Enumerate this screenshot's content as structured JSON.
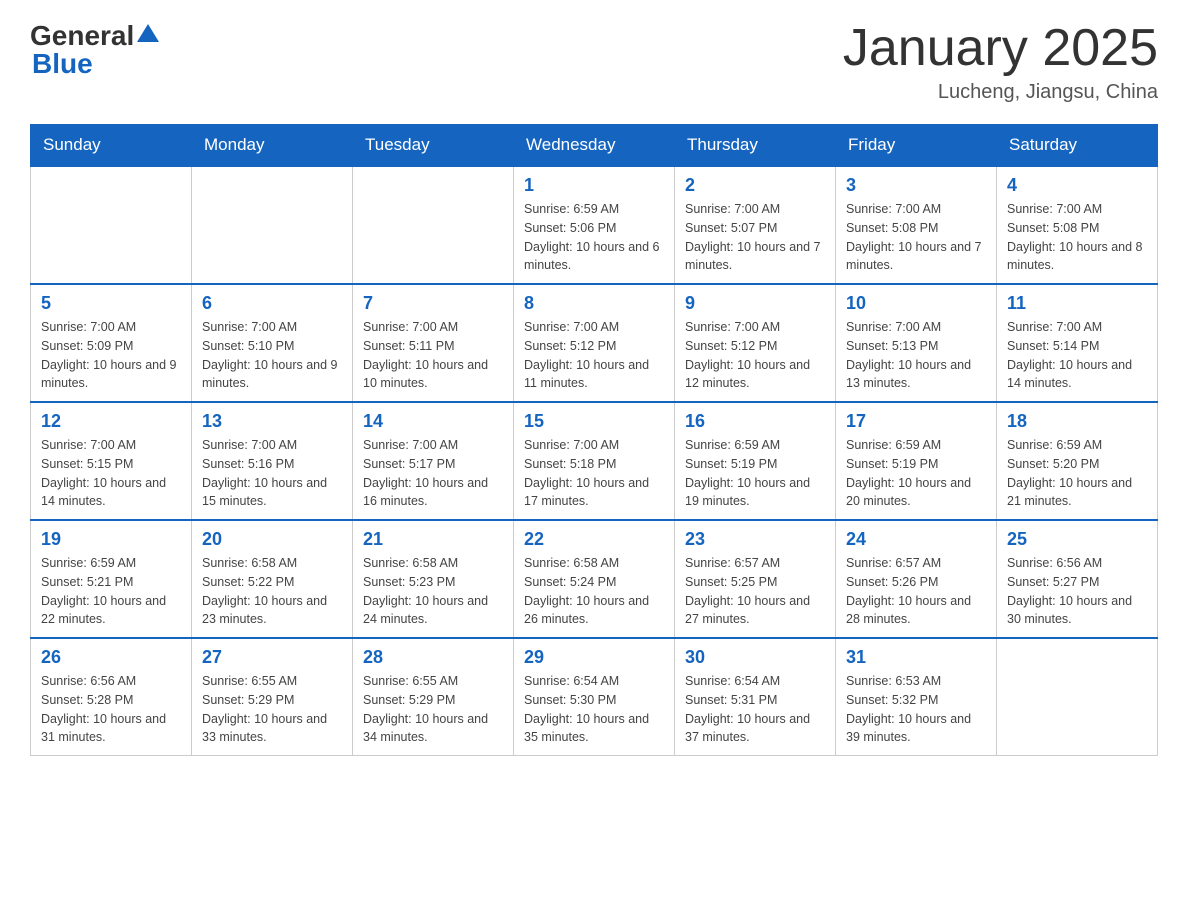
{
  "logo": {
    "general": "General",
    "blue": "Blue"
  },
  "header": {
    "title": "January 2025",
    "subtitle": "Lucheng, Jiangsu, China"
  },
  "weekdays": [
    "Sunday",
    "Monday",
    "Tuesday",
    "Wednesday",
    "Thursday",
    "Friday",
    "Saturday"
  ],
  "weeks": [
    [
      {
        "day": "",
        "info": ""
      },
      {
        "day": "",
        "info": ""
      },
      {
        "day": "",
        "info": ""
      },
      {
        "day": "1",
        "info": "Sunrise: 6:59 AM\nSunset: 5:06 PM\nDaylight: 10 hours and 6 minutes."
      },
      {
        "day": "2",
        "info": "Sunrise: 7:00 AM\nSunset: 5:07 PM\nDaylight: 10 hours and 7 minutes."
      },
      {
        "day": "3",
        "info": "Sunrise: 7:00 AM\nSunset: 5:08 PM\nDaylight: 10 hours and 7 minutes."
      },
      {
        "day": "4",
        "info": "Sunrise: 7:00 AM\nSunset: 5:08 PM\nDaylight: 10 hours and 8 minutes."
      }
    ],
    [
      {
        "day": "5",
        "info": "Sunrise: 7:00 AM\nSunset: 5:09 PM\nDaylight: 10 hours and 9 minutes."
      },
      {
        "day": "6",
        "info": "Sunrise: 7:00 AM\nSunset: 5:10 PM\nDaylight: 10 hours and 9 minutes."
      },
      {
        "day": "7",
        "info": "Sunrise: 7:00 AM\nSunset: 5:11 PM\nDaylight: 10 hours and 10 minutes."
      },
      {
        "day": "8",
        "info": "Sunrise: 7:00 AM\nSunset: 5:12 PM\nDaylight: 10 hours and 11 minutes."
      },
      {
        "day": "9",
        "info": "Sunrise: 7:00 AM\nSunset: 5:12 PM\nDaylight: 10 hours and 12 minutes."
      },
      {
        "day": "10",
        "info": "Sunrise: 7:00 AM\nSunset: 5:13 PM\nDaylight: 10 hours and 13 minutes."
      },
      {
        "day": "11",
        "info": "Sunrise: 7:00 AM\nSunset: 5:14 PM\nDaylight: 10 hours and 14 minutes."
      }
    ],
    [
      {
        "day": "12",
        "info": "Sunrise: 7:00 AM\nSunset: 5:15 PM\nDaylight: 10 hours and 14 minutes."
      },
      {
        "day": "13",
        "info": "Sunrise: 7:00 AM\nSunset: 5:16 PM\nDaylight: 10 hours and 15 minutes."
      },
      {
        "day": "14",
        "info": "Sunrise: 7:00 AM\nSunset: 5:17 PM\nDaylight: 10 hours and 16 minutes."
      },
      {
        "day": "15",
        "info": "Sunrise: 7:00 AM\nSunset: 5:18 PM\nDaylight: 10 hours and 17 minutes."
      },
      {
        "day": "16",
        "info": "Sunrise: 6:59 AM\nSunset: 5:19 PM\nDaylight: 10 hours and 19 minutes."
      },
      {
        "day": "17",
        "info": "Sunrise: 6:59 AM\nSunset: 5:19 PM\nDaylight: 10 hours and 20 minutes."
      },
      {
        "day": "18",
        "info": "Sunrise: 6:59 AM\nSunset: 5:20 PM\nDaylight: 10 hours and 21 minutes."
      }
    ],
    [
      {
        "day": "19",
        "info": "Sunrise: 6:59 AM\nSunset: 5:21 PM\nDaylight: 10 hours and 22 minutes."
      },
      {
        "day": "20",
        "info": "Sunrise: 6:58 AM\nSunset: 5:22 PM\nDaylight: 10 hours and 23 minutes."
      },
      {
        "day": "21",
        "info": "Sunrise: 6:58 AM\nSunset: 5:23 PM\nDaylight: 10 hours and 24 minutes."
      },
      {
        "day": "22",
        "info": "Sunrise: 6:58 AM\nSunset: 5:24 PM\nDaylight: 10 hours and 26 minutes."
      },
      {
        "day": "23",
        "info": "Sunrise: 6:57 AM\nSunset: 5:25 PM\nDaylight: 10 hours and 27 minutes."
      },
      {
        "day": "24",
        "info": "Sunrise: 6:57 AM\nSunset: 5:26 PM\nDaylight: 10 hours and 28 minutes."
      },
      {
        "day": "25",
        "info": "Sunrise: 6:56 AM\nSunset: 5:27 PM\nDaylight: 10 hours and 30 minutes."
      }
    ],
    [
      {
        "day": "26",
        "info": "Sunrise: 6:56 AM\nSunset: 5:28 PM\nDaylight: 10 hours and 31 minutes."
      },
      {
        "day": "27",
        "info": "Sunrise: 6:55 AM\nSunset: 5:29 PM\nDaylight: 10 hours and 33 minutes."
      },
      {
        "day": "28",
        "info": "Sunrise: 6:55 AM\nSunset: 5:29 PM\nDaylight: 10 hours and 34 minutes."
      },
      {
        "day": "29",
        "info": "Sunrise: 6:54 AM\nSunset: 5:30 PM\nDaylight: 10 hours and 35 minutes."
      },
      {
        "day": "30",
        "info": "Sunrise: 6:54 AM\nSunset: 5:31 PM\nDaylight: 10 hours and 37 minutes."
      },
      {
        "day": "31",
        "info": "Sunrise: 6:53 AM\nSunset: 5:32 PM\nDaylight: 10 hours and 39 minutes."
      },
      {
        "day": "",
        "info": ""
      }
    ]
  ]
}
